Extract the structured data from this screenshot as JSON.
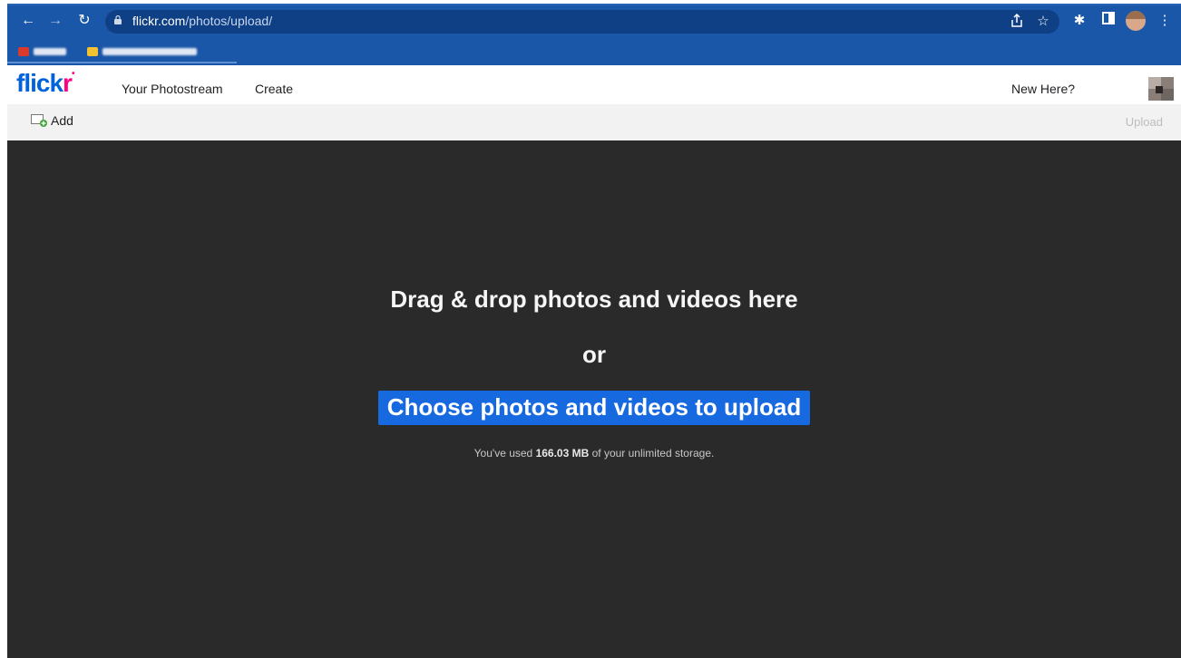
{
  "browser": {
    "url_host": "flickr.com",
    "url_path": "/photos/upload/",
    "icons": {
      "back": "arrow-left-icon",
      "forward": "arrow-right-icon",
      "reload": "reload-icon",
      "lock": "lock-icon",
      "share": "share-icon",
      "bookmark": "star-icon",
      "extensions": "puzzle-icon",
      "sidepanel": "sidepanel-icon",
      "menu": "kebab-menu-icon"
    },
    "colors": {
      "toolbar": "#1b57a8",
      "omnibox": "#0f3f85"
    }
  },
  "flickr_nav": {
    "logo_part1": "flick",
    "logo_part2": "r",
    "links": [
      "Your Photostream",
      "Create"
    ],
    "new_here": "New Here?",
    "colors": {
      "logo_blue": "#0063dc",
      "logo_pink": "#ff0084"
    }
  },
  "toolbar": {
    "add_label": "Add",
    "upload_label": "Upload"
  },
  "dropzone": {
    "title": "Drag & drop photos and videos here",
    "or": "or",
    "choose_label": "Choose photos and videos to upload",
    "storage_prefix": "You've used ",
    "storage_amount": "166.03 MB",
    "storage_suffix": " of your unlimited storage.",
    "colors": {
      "background": "#2a2a2a",
      "button": "#1769e0"
    }
  }
}
